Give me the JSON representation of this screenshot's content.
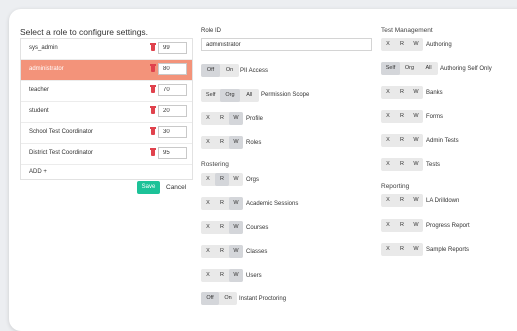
{
  "roles": {
    "title": "Select a role to configure settings.",
    "items": [
      {
        "name": "sys_admin",
        "value": "99"
      },
      {
        "name": "administrator",
        "value": "80"
      },
      {
        "name": "teacher",
        "value": "70"
      },
      {
        "name": "student",
        "value": "20"
      },
      {
        "name": "School Test Coordinator",
        "value": "30"
      },
      {
        "name": "District Test Coordinator",
        "value": "95"
      }
    ],
    "add_label": "ADD +",
    "save_label": "Save",
    "cancel_label": "Cancel"
  },
  "role_id": {
    "label": "Role ID",
    "value": "administrator"
  },
  "general": {
    "pii": {
      "options": [
        "Off",
        "On"
      ],
      "selected": "Off",
      "label": "PII Access"
    },
    "scope": {
      "options": [
        "Self",
        "Org",
        "All"
      ],
      "selected": "Org",
      "label": "Permission Scope"
    },
    "profile": {
      "options": [
        "X",
        "R",
        "W"
      ],
      "selected": "W",
      "label": "Profile"
    },
    "roles": {
      "options": [
        "X",
        "R",
        "W"
      ],
      "selected": "W",
      "label": "Roles"
    }
  },
  "rostering": {
    "title": "Rostering",
    "orgs": {
      "options": [
        "X",
        "R",
        "W"
      ],
      "selected": "R",
      "label": "Orgs"
    },
    "sessions": {
      "options": [
        "X",
        "R",
        "W"
      ],
      "selected": "W",
      "label": "Academic Sessions"
    },
    "courses": {
      "options": [
        "X",
        "R",
        "W"
      ],
      "selected": "W",
      "label": "Courses"
    },
    "classes": {
      "options": [
        "X",
        "R",
        "W"
      ],
      "selected": "W",
      "label": "Classes"
    },
    "users": {
      "options": [
        "X",
        "R",
        "W"
      ],
      "selected": "W",
      "label": "Users"
    },
    "instant": {
      "options": [
        "Off",
        "On"
      ],
      "selected": "Off",
      "label": "Instant Proctoring"
    }
  },
  "test_management": {
    "title": "Test Management",
    "authoring": {
      "options": [
        "X",
        "R",
        "W"
      ],
      "selected": "",
      "label": "Authoring"
    },
    "authoring_self": {
      "options": [
        "Self",
        "Org",
        "All"
      ],
      "selected": "Self",
      "label": "Authoring Self Only"
    },
    "banks": {
      "options": [
        "X",
        "R",
        "W"
      ],
      "selected": "",
      "label": "Banks"
    },
    "forms": {
      "options": [
        "X",
        "R",
        "W"
      ],
      "selected": "",
      "label": "Forms"
    },
    "admin_tests": {
      "options": [
        "X",
        "R",
        "W"
      ],
      "selected": "",
      "label": "Admin Tests"
    },
    "tests": {
      "options": [
        "X",
        "R",
        "W"
      ],
      "selected": "",
      "label": "Tests"
    }
  },
  "reporting": {
    "title": "Reporting",
    "la_drilldown": {
      "options": [
        "X",
        "R",
        "W"
      ],
      "selected": "",
      "label": "LA Drilldown"
    },
    "progress": {
      "options": [
        "X",
        "R",
        "W"
      ],
      "selected": "",
      "label": "Progress Report"
    },
    "sample": {
      "options": [
        "X",
        "R",
        "W"
      ],
      "selected": "",
      "label": "Sample Reports"
    }
  },
  "colors": {
    "accent": "#f3937a",
    "save": "#1cc298",
    "trash": "#e0424d"
  }
}
